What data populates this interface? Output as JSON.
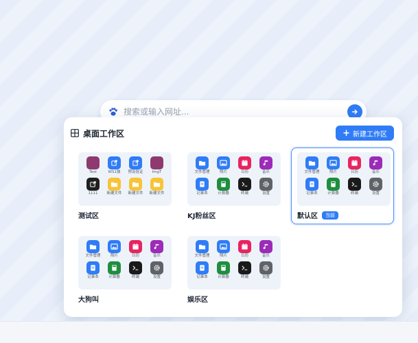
{
  "search": {
    "placeholder": "搜索或输入网址..."
  },
  "panel": {
    "title": "桌面工作区",
    "new_button_label": "新建工作区",
    "current_badge": "当前"
  },
  "colors": {
    "accent": "#2f7cf6"
  },
  "workspaces": [
    {
      "name": "测试区",
      "active": false,
      "apps": [
        {
          "label": "Test",
          "color": "#8e3a6e",
          "icon": "blank-icon"
        },
        {
          "label": "WS1独",
          "color": "#2f7cf6",
          "icon": "external-link-icon"
        },
        {
          "label": "预设验证",
          "color": "#2f7cf6",
          "icon": "external-link-icon"
        },
        {
          "label": "ImgT",
          "color": "#8e3a6e",
          "icon": "blank-icon"
        },
        {
          "label": "1111",
          "color": "#1f1f1f",
          "icon": "external-link-icon"
        },
        {
          "label": "新建文件",
          "color": "#f7c437",
          "icon": "folder-icon"
        },
        {
          "label": "新建文件",
          "color": "#f7c437",
          "icon": "folder-icon"
        },
        {
          "label": "新建文件",
          "color": "#f7c437",
          "icon": "folder-icon"
        }
      ]
    },
    {
      "name": "KJ粉丝区",
      "active": false,
      "apps": [
        {
          "label": "文件管理",
          "color": "#2f7cf6",
          "icon": "folder-icon"
        },
        {
          "label": "照片",
          "color": "#2f7cf6",
          "icon": "photo-icon"
        },
        {
          "label": "日历",
          "color": "#e8245f",
          "icon": "calendar-icon"
        },
        {
          "label": "音乐",
          "color": "#9c2bb8",
          "icon": "music-icon"
        },
        {
          "label": "记事本",
          "color": "#2f7cf6",
          "icon": "notepad-icon"
        },
        {
          "label": "计算器",
          "color": "#1e8e3e",
          "icon": "calculator-icon"
        },
        {
          "label": "终端",
          "color": "#1a1a1a",
          "icon": "terminal-icon"
        },
        {
          "label": "设置",
          "color": "#5f6368",
          "icon": "gear-icon"
        }
      ]
    },
    {
      "name": "默认区",
      "active": true,
      "apps": [
        {
          "label": "文件管理",
          "color": "#2f7cf6",
          "icon": "folder-icon"
        },
        {
          "label": "照片",
          "color": "#2f7cf6",
          "icon": "photo-icon"
        },
        {
          "label": "日历",
          "color": "#e8245f",
          "icon": "calendar-icon"
        },
        {
          "label": "音乐",
          "color": "#9c2bb8",
          "icon": "music-icon"
        },
        {
          "label": "记事本",
          "color": "#2f7cf6",
          "icon": "notepad-icon"
        },
        {
          "label": "计算器",
          "color": "#1e8e3e",
          "icon": "calculator-icon"
        },
        {
          "label": "终端",
          "color": "#1a1a1a",
          "icon": "terminal-icon"
        },
        {
          "label": "设置",
          "color": "#5f6368",
          "icon": "gear-icon"
        }
      ]
    },
    {
      "name": "大狗叫",
      "active": false,
      "apps": [
        {
          "label": "文件管理",
          "color": "#2f7cf6",
          "icon": "folder-icon"
        },
        {
          "label": "照片",
          "color": "#2f7cf6",
          "icon": "photo-icon"
        },
        {
          "label": "日历",
          "color": "#e8245f",
          "icon": "calendar-icon"
        },
        {
          "label": "音乐",
          "color": "#9c2bb8",
          "icon": "music-icon"
        },
        {
          "label": "记事本",
          "color": "#2f7cf6",
          "icon": "notepad-icon"
        },
        {
          "label": "计算器",
          "color": "#1e8e3e",
          "icon": "calculator-icon"
        },
        {
          "label": "终端",
          "color": "#1a1a1a",
          "icon": "terminal-icon"
        },
        {
          "label": "设置",
          "color": "#5f6368",
          "icon": "gear-icon"
        }
      ]
    },
    {
      "name": "娱乐区",
      "active": false,
      "apps": [
        {
          "label": "文件管理",
          "color": "#2f7cf6",
          "icon": "folder-icon"
        },
        {
          "label": "照片",
          "color": "#2f7cf6",
          "icon": "photo-icon"
        },
        {
          "label": "日历",
          "color": "#e8245f",
          "icon": "calendar-icon"
        },
        {
          "label": "音乐",
          "color": "#9c2bb8",
          "icon": "music-icon"
        },
        {
          "label": "记事本",
          "color": "#2f7cf6",
          "icon": "notepad-icon"
        },
        {
          "label": "计算器",
          "color": "#1e8e3e",
          "icon": "calculator-icon"
        },
        {
          "label": "终端",
          "color": "#1a1a1a",
          "icon": "terminal-icon"
        },
        {
          "label": "设置",
          "color": "#5f6368",
          "icon": "gear-icon"
        }
      ]
    }
  ]
}
